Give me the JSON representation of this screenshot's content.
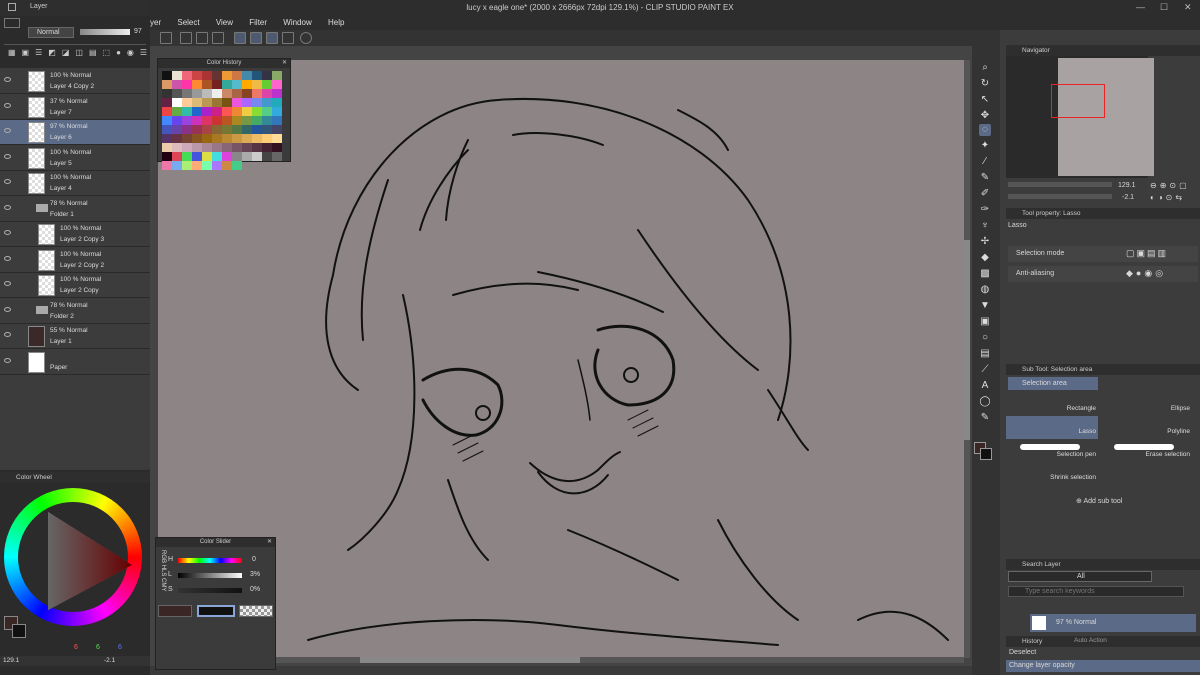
{
  "window": {
    "title": "lucy x eagle one* (2000 x 2666px 72dpi 129.1%) - CLIP STUDIO PAINT EX"
  },
  "menu": [
    "yer",
    "Select",
    "View",
    "Filter",
    "Window",
    "Help"
  ],
  "layer_panel": {
    "title": "Layer",
    "blend_mode": "Normal",
    "opacity": "97",
    "layers": [
      {
        "opacity": "100 % Normal",
        "name": "Layer 4 Copy 2",
        "indent": 0,
        "selected": false
      },
      {
        "opacity": "37 % Normal",
        "name": "Layer 7",
        "indent": 0,
        "selected": false
      },
      {
        "opacity": "97 % Normal",
        "name": "Layer 6",
        "indent": 0,
        "selected": true
      },
      {
        "opacity": "100 % Normal",
        "name": "Layer 5",
        "indent": 0,
        "selected": false
      },
      {
        "opacity": "100 % Normal",
        "name": "Layer 4",
        "indent": 0,
        "selected": false
      },
      {
        "opacity": "78 % Normal",
        "name": "Folder 1",
        "indent": 0,
        "selected": false,
        "folder": true
      },
      {
        "opacity": "100 % Normal",
        "name": "Layer 2 Copy 3",
        "indent": 1,
        "selected": false
      },
      {
        "opacity": "100 % Normal",
        "name": "Layer 2 Copy 2",
        "indent": 1,
        "selected": false
      },
      {
        "opacity": "100 % Normal",
        "name": "Layer 2 Copy",
        "indent": 1,
        "selected": false
      },
      {
        "opacity": "78 % Normal",
        "name": "Folder 2",
        "indent": 0,
        "selected": false,
        "folder": true
      },
      {
        "opacity": "55 % Normal",
        "name": "Layer 1",
        "indent": 0,
        "selected": false
      },
      {
        "opacity": "",
        "name": "Paper",
        "indent": 0,
        "selected": false
      }
    ]
  },
  "color_wheel": {
    "title": "Color Wheel",
    "r": "6",
    "g": "6",
    "b": "6",
    "zoom": "129.1",
    "angle": "-2.1"
  },
  "color_history": {
    "title": "Color History"
  },
  "color_slider": {
    "title": "Color Slider",
    "h_label": "H",
    "h_val": "0",
    "l_label": "L",
    "l_val": "3%",
    "s_label": "S",
    "s_val": "0%",
    "tabs": [
      "RGB",
      "HLS",
      "CMY"
    ]
  },
  "navigator": {
    "title": "Navigator",
    "zoom": "129.1",
    "angle": "-2.1"
  },
  "tool_property": {
    "title": "Tool property: Lasso",
    "tool_name": "Lasso",
    "selection_mode_label": "Selection mode",
    "anti_aliasing_label": "Anti-aliasing"
  },
  "sub_tool": {
    "title": "Sub Tool: Selection area",
    "tab": "Selection area",
    "items": [
      "Rectangle",
      "Ellipse",
      "Lasso",
      "Polyline",
      "Selection pen",
      "Erase selection",
      "Shrink selection"
    ],
    "add_label": "Add sub tool"
  },
  "search_layer": {
    "title": "Search Layer",
    "filter": "All",
    "placeholder": "Type search keywords",
    "result": "97 % Normal"
  },
  "history": {
    "title": "History",
    "tab2": "Auto Action",
    "items": [
      "Deselect",
      "Change layer opacity"
    ]
  },
  "colors": {
    "accent": "#5b6a87",
    "canvas": "#8c8485",
    "panel": "#3c3c3c"
  }
}
